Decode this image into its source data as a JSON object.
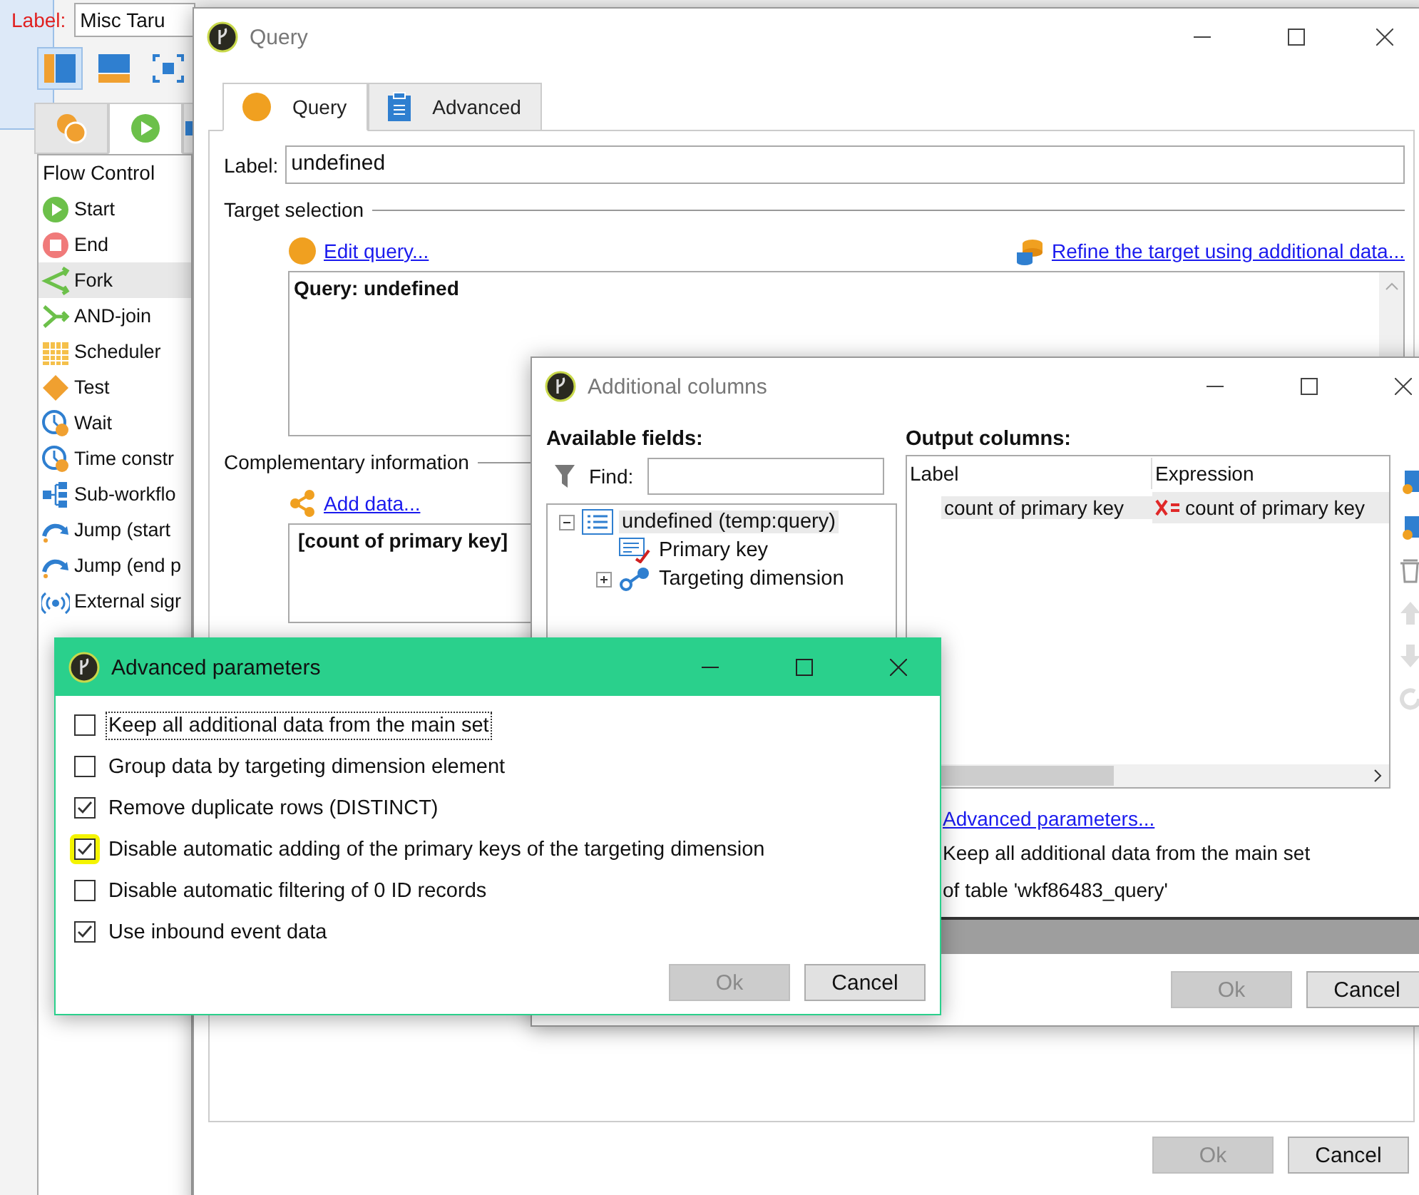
{
  "background_app": {
    "label_caption": "Label:",
    "label_value": "Misc Taru",
    "toolbar": [
      {
        "pressed": true
      },
      {
        "pressed": false
      },
      {
        "pressed": false
      }
    ],
    "palette_tabs": [
      {
        "selected": false
      },
      {
        "selected": true
      },
      {
        "selected": false
      }
    ],
    "palette": {
      "heading": "Flow Control",
      "items": [
        {
          "label": "Start",
          "selected": false
        },
        {
          "label": "End",
          "selected": false
        },
        {
          "label": "Fork",
          "selected": true
        },
        {
          "label": "AND-join",
          "selected": false
        },
        {
          "label": "Scheduler",
          "selected": false
        },
        {
          "label": "Test",
          "selected": false
        },
        {
          "label": "Wait",
          "selected": false
        },
        {
          "label": "Time constr",
          "selected": false
        },
        {
          "label": "Sub-workflo",
          "selected": false
        },
        {
          "label": "Jump (start",
          "selected": false
        },
        {
          "label": "Jump (end p",
          "selected": false
        },
        {
          "label": "External sigr",
          "selected": false
        }
      ]
    }
  },
  "query_window": {
    "title": "Query",
    "tabs": [
      {
        "label": "Query",
        "selected": true
      },
      {
        "label": "Advanced",
        "selected": false
      }
    ],
    "label_caption": "Label:",
    "label_value": "undefined",
    "target_heading": "Target selection",
    "edit_link": "Edit query...",
    "refine_link": "Refine the target using additional data...",
    "query_text": "Query: undefined",
    "complementary_heading": "Complementary information",
    "add_data_link": "Add data...",
    "additional_text": "[count of primary key]",
    "buttons": [
      {
        "label": "Ok",
        "disabled": true
      },
      {
        "label": "Cancel",
        "disabled": false
      }
    ]
  },
  "additional_columns_window": {
    "title": "Additional columns",
    "available_heading": "Available fields:",
    "find_caption": "Find:",
    "tree": [
      {
        "label": "undefined (temp:query)",
        "selected": true,
        "expanded": true,
        "children": [
          {
            "label": "Primary key",
            "kind": "field"
          },
          {
            "label": "Targeting dimension",
            "kind": "link",
            "expanded": false
          }
        ]
      }
    ],
    "output_heading": "Output columns:",
    "columns": [
      "Label",
      "Expression"
    ],
    "rows": [
      {
        "label": "count of primary key",
        "expression": "count of primary key",
        "selected": true
      }
    ],
    "advanced_link": "Advanced parameters...",
    "summary_lines": [
      "Keep all additional data from the main set",
      "of table 'wkf86483_query'"
    ],
    "buttons": [
      {
        "label": "Ok",
        "disabled": true
      },
      {
        "label": "Cancel",
        "disabled": false
      }
    ]
  },
  "advanced_parameters_window": {
    "title": "Advanced parameters",
    "options": [
      {
        "label": "Keep all additional data from the main set",
        "checked": false,
        "focused": true,
        "highlighted": false
      },
      {
        "label": "Group data by targeting dimension element",
        "checked": false,
        "focused": false,
        "highlighted": false
      },
      {
        "label": "Remove duplicate rows (DISTINCT)",
        "checked": true,
        "focused": false,
        "highlighted": false
      },
      {
        "label": "Disable automatic adding of the primary keys of the targeting dimension",
        "checked": true,
        "focused": false,
        "highlighted": true
      },
      {
        "label": "Disable automatic filtering of 0 ID records",
        "checked": false,
        "focused": false,
        "highlighted": false
      },
      {
        "label": "Use inbound event data",
        "checked": true,
        "focused": false,
        "highlighted": false
      }
    ],
    "buttons": [
      {
        "label": "Ok",
        "disabled": true
      },
      {
        "label": "Cancel",
        "disabled": false
      }
    ]
  }
}
